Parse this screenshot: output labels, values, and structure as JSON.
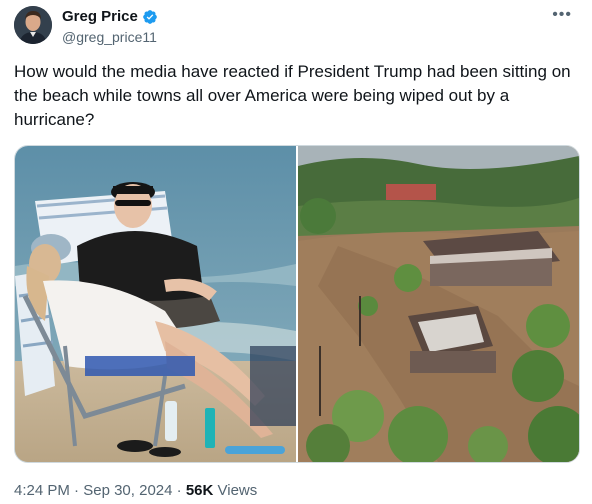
{
  "author": {
    "display_name": "Greg Price",
    "handle": "@greg_price11",
    "verified": true,
    "verified_color": "#1d9bf0"
  },
  "more_icon": "ellipsis-icon",
  "tweet": {
    "text": "How would the media have reacted if President Trump had been sitting on the beach while towns all over America were being wiped out by a hurricane?"
  },
  "media": [
    {
      "subject": "beach-photo"
    },
    {
      "subject": "flood-aerial-photo"
    }
  ],
  "meta": {
    "time": "4:24 PM",
    "separator1": "·",
    "date": "Sep 30, 2024",
    "separator2": "·",
    "views_count": "56K",
    "views_label": "Views"
  },
  "colors": {
    "text": "#0f1419",
    "secondary": "#536471",
    "border": "#cfd9de"
  }
}
